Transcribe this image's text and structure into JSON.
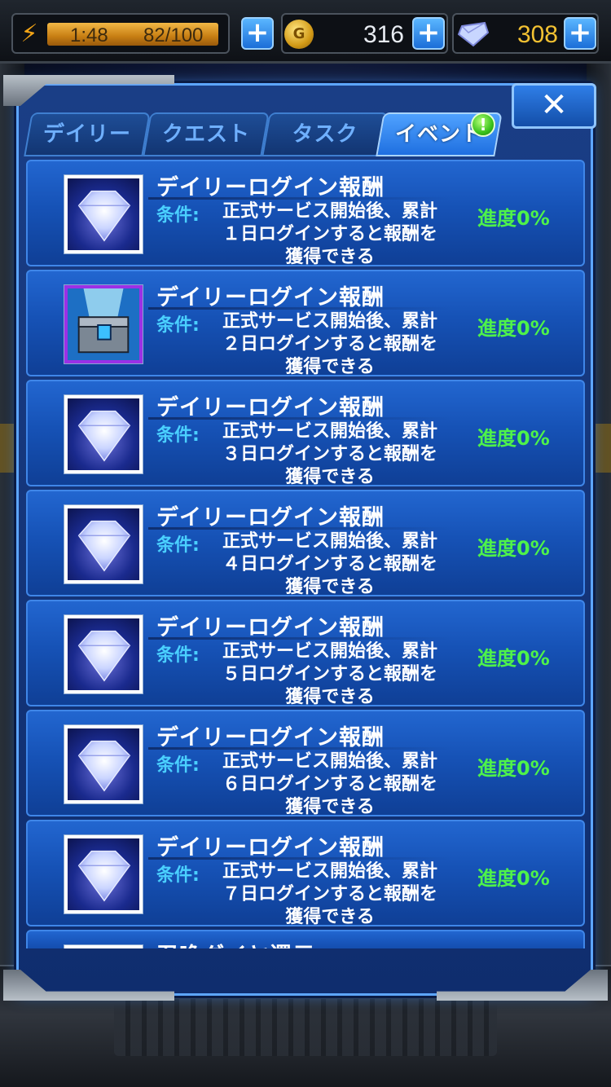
{
  "status": {
    "stamina_time": "1:48",
    "stamina_value": "82/100",
    "stamina_fill": 1.0,
    "gold": "316",
    "gems": "308"
  },
  "tabs": [
    {
      "label": "デイリー",
      "active": false
    },
    {
      "label": "クエスト",
      "active": false
    },
    {
      "label": "タスク",
      "active": false
    },
    {
      "label": "イベント",
      "active": true
    }
  ],
  "tab_badge": "!",
  "close_label": "✕",
  "condition_label": "条件:",
  "rows": [
    {
      "title": "デイリーログイン報酬",
      "cond1": "正式サービス開始後、累計",
      "cond2": "１日ログインすると報酬を",
      "cond3": "獲得できる",
      "progress": "進度0%",
      "icon": "diamond-icon"
    },
    {
      "title": "デイリーログイン報酬",
      "cond1": "正式サービス開始後、累計",
      "cond2": "２日ログインすると報酬を",
      "cond3": "獲得できる",
      "progress": "進度0%",
      "icon": "chest-icon"
    },
    {
      "title": "デイリーログイン報酬",
      "cond1": "正式サービス開始後、累計",
      "cond2": "３日ログインすると報酬を",
      "cond3": "獲得できる",
      "progress": "進度0%",
      "icon": "diamond-icon"
    },
    {
      "title": "デイリーログイン報酬",
      "cond1": "正式サービス開始後、累計",
      "cond2": "４日ログインすると報酬を",
      "cond3": "獲得できる",
      "progress": "進度0%",
      "icon": "diamond-icon"
    },
    {
      "title": "デイリーログイン報酬",
      "cond1": "正式サービス開始後、累計",
      "cond2": "５日ログインすると報酬を",
      "cond3": "獲得できる",
      "progress": "進度0%",
      "icon": "diamond-icon"
    },
    {
      "title": "デイリーログイン報酬",
      "cond1": "正式サービス開始後、累計",
      "cond2": "６日ログインすると報酬を",
      "cond3": "獲得できる",
      "progress": "進度0%",
      "icon": "diamond-icon"
    },
    {
      "title": "デイリーログイン報酬",
      "cond1": "正式サービス開始後、累計",
      "cond2": "７日ログインすると報酬を",
      "cond3": "獲得できる",
      "progress": "進度0%",
      "icon": "diamond-icon"
    }
  ],
  "partial_row_title": "召喚ダイヤ還元"
}
